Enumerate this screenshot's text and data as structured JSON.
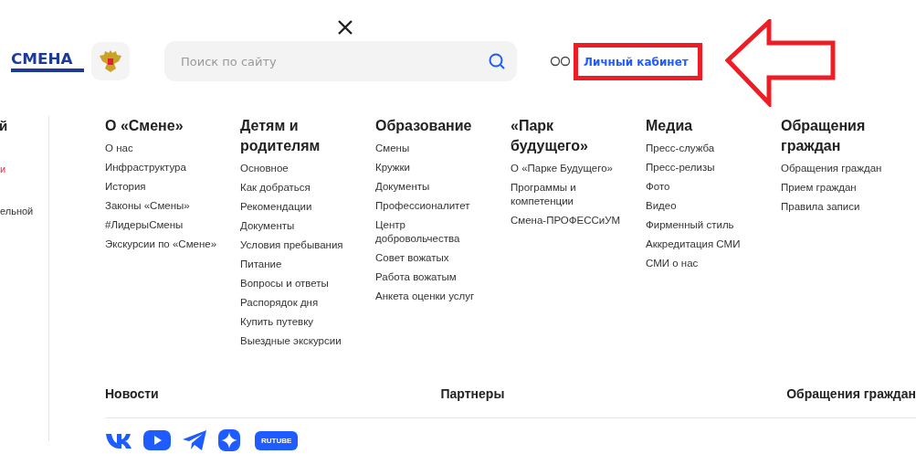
{
  "logo": {
    "text": "СМЕНА"
  },
  "search": {
    "placeholder": "Поиск по сайту"
  },
  "account_link": {
    "label": "Личный кабинет"
  },
  "left_column": {
    "heading": "й",
    "items": [
      {
        "label": "и",
        "selected": true
      },
      {
        "label": "ельной",
        "selected": false
      }
    ]
  },
  "menu_columns": [
    {
      "heading": "О «Смене»",
      "items": [
        "О нас",
        "Инфраструктура",
        "История",
        "Законы «Смены»",
        "#ЛидерыСмены",
        "Экскурсии по «Смене»"
      ]
    },
    {
      "heading": "Детям и родителям",
      "items": [
        "Основное",
        "Как добраться",
        "Рекомендации",
        "Документы",
        "Условия пребывания",
        "Питание",
        "Вопросы и ответы",
        "Распорядок дня",
        "Купить путевку",
        "Выездные экскурсии"
      ]
    },
    {
      "heading": "Образование",
      "items": [
        "Смены",
        "Кружки",
        "Документы",
        "Профессионалитет",
        "Центр добровольчества",
        "Совет вожатых",
        "Работа вожатым",
        "Анкета оценки услуг"
      ]
    },
    {
      "heading": "«Парк будущего»",
      "items": [
        "О «Парке Будущего»",
        "Программы и компетенции",
        "Смена-ПРОФЕССиУМ"
      ]
    },
    {
      "heading": "Медиа",
      "items": [
        "Пресс-служба",
        "Пресс-релизы",
        "Фото",
        "Видео",
        "Фирменный стиль",
        "Аккредитация СМИ",
        "СМИ о нас"
      ]
    },
    {
      "heading": "Обращения граждан",
      "items": [
        "Обращения граждан",
        "Прием граждан",
        "Правила записи"
      ]
    }
  ],
  "bottom_links": [
    "Новости",
    "Партнеры",
    "Обращения граждан"
  ],
  "social": [
    {
      "kind": "vk"
    },
    {
      "kind": "youtube"
    },
    {
      "kind": "telegram"
    },
    {
      "kind": "sparkle"
    },
    {
      "kind": "badge",
      "label": "RUTUBE"
    }
  ]
}
